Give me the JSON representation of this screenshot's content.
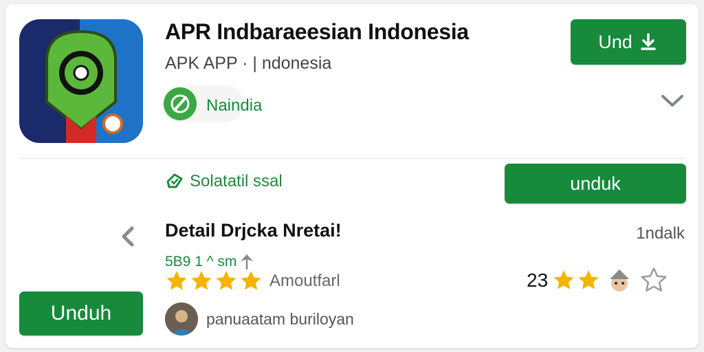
{
  "app": {
    "title": "APR Indbaraeesian Indonesia",
    "subtitle": "APK  APP · | ndonesia",
    "developer_label": "Naindia"
  },
  "buttons": {
    "top_label": "Und",
    "middle_label": "unduk",
    "bottom_label": "Unduh"
  },
  "safety": {
    "label": "Solatatil ssal"
  },
  "details": {
    "title": "Detail Drjcka Nretai!",
    "right_label": "1ndalk",
    "stats_text": "5B9  1   ^  sm",
    "reviews_label": "Amoutfarl",
    "rating_value": "23",
    "user_text": "panuaatam buriloyan"
  },
  "icons": [
    "app-icon",
    "download-icon",
    "developer-badge-icon",
    "chevron-down-icon",
    "shield-check-icon",
    "chevron-left-icon",
    "star-icon",
    "star-outline-icon",
    "avatar"
  ],
  "colors": {
    "accent_green": "#178a3c",
    "text_green": "#1a8a3e",
    "star_yellow": "#f5b400",
    "icon_navy": "#1b2a6b",
    "icon_blue": "#1e73c8",
    "icon_green": "#5cb83b",
    "icon_red": "#d42a26"
  }
}
